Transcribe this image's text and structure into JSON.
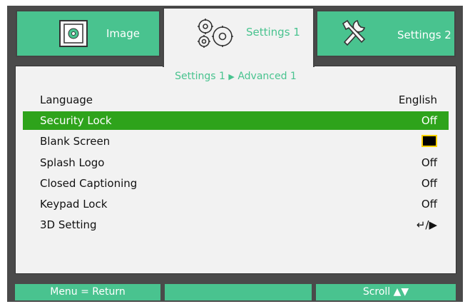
{
  "tabs": [
    {
      "label": "Image",
      "icon": "image-settings-icon"
    },
    {
      "label": "Settings 1",
      "icon": "gears-icon",
      "active": true
    },
    {
      "label": "Settings 2",
      "icon": "tools-icon"
    }
  ],
  "breadcrumb": {
    "parent": "Settings 1",
    "separator": "▶",
    "current": "Advanced 1"
  },
  "menu": {
    "items": [
      {
        "label": "Language",
        "value": "English"
      },
      {
        "label": "Security Lock",
        "value": "Off",
        "selected": true
      },
      {
        "label": "Blank Screen",
        "value": "",
        "value_type": "color-swatch"
      },
      {
        "label": "Splash Logo",
        "value": "Off"
      },
      {
        "label": "Closed Captioning",
        "value": "Off"
      },
      {
        "label": "Keypad Lock",
        "value": "Off"
      },
      {
        "label": "3D Setting",
        "value": "↵/▶"
      }
    ]
  },
  "footer": {
    "left": "Menu = Return",
    "middle": "",
    "right": "Scroll ▲▼"
  },
  "colors": {
    "accent_green": "#49c38f",
    "selected_row": "#2ea31b",
    "frame": "#4a4a4a",
    "panel": "#f2f2f2",
    "swatch_fill": "#000000",
    "swatch_border": "#ffd200"
  }
}
